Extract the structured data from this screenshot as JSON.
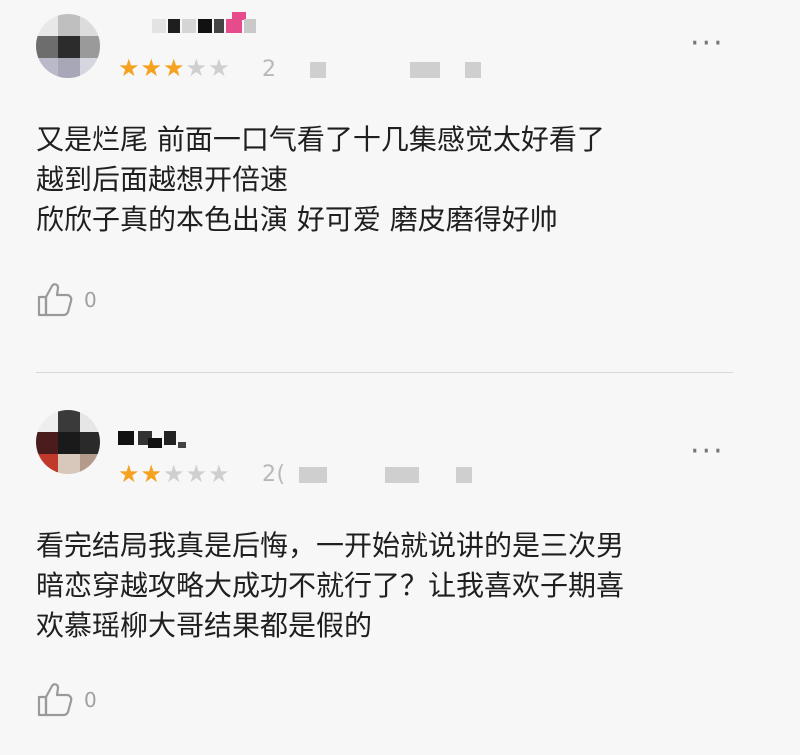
{
  "reviews": [
    {
      "rating": 3,
      "max_rating": 5,
      "date_partial": "2",
      "more_label": "···",
      "lines": [
        "又是烂尾 前面一口气看了十几集感觉太好看了",
        "越到后面越想开倍速",
        "欣欣子真的本色出演 好可爱  磨皮磨得好帅"
      ],
      "like_count": "0"
    },
    {
      "rating": 2,
      "max_rating": 5,
      "date_partial": "2(",
      "more_label": "···",
      "lines": [
        "看完结局我真是后悔，一开始就说讲的是三次男",
        "暗恋穿越攻略大成功不就行了？让我喜欢子期喜",
        "欢慕瑶柳大哥结果都是假的"
      ],
      "like_count": "0"
    }
  ],
  "colors": {
    "star_on": "#f4a21f",
    "star_off": "#cfcfcf",
    "background": "#f7f7f7"
  }
}
